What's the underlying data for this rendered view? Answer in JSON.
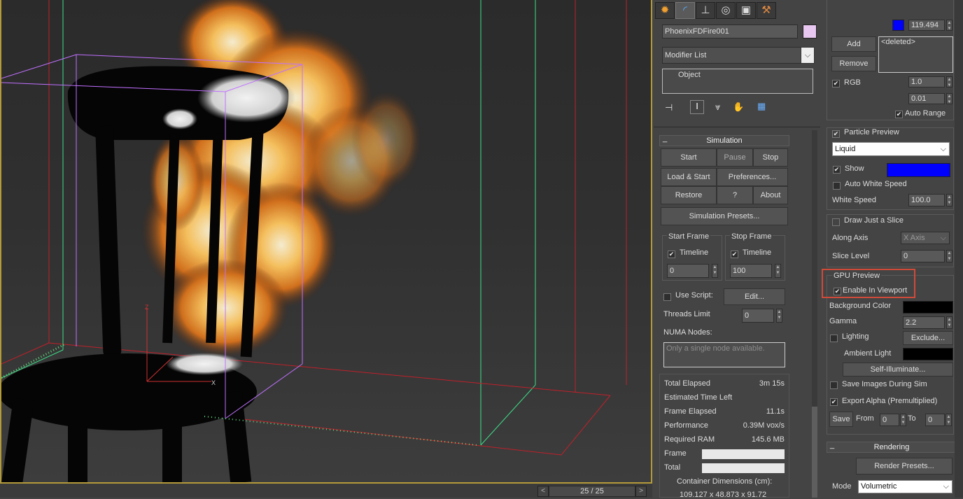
{
  "viewport": {
    "gizmo_axes": {
      "x": "X",
      "z": "Z"
    }
  },
  "timebar": {
    "frame_readout": "25 / 25",
    "prev_label": "<",
    "next_label": ">"
  },
  "command_panel": {
    "tabs": [
      {
        "name": "create",
        "icon": "sun-icon"
      },
      {
        "name": "modify",
        "icon": "modify-arc-icon"
      },
      {
        "name": "hierarchy",
        "icon": "hierarchy-icon"
      },
      {
        "name": "motion",
        "icon": "motion-circle-icon"
      },
      {
        "name": "display",
        "icon": "display-monitor-icon"
      },
      {
        "name": "utilities",
        "icon": "hammer-icon"
      }
    ],
    "object_name": "PhoenixFDFire001",
    "object_color": "#e8c8f0",
    "modifier_list_label": "Modifier List",
    "stack_items": [
      "Object"
    ],
    "simulation": {
      "title": "Simulation",
      "start": "Start",
      "pause": "Pause",
      "stop": "Stop",
      "load_start": "Load & Start",
      "preferences": "Preferences...",
      "restore": "Restore",
      "help": "?",
      "about": "About",
      "presets": "Simulation Presets...",
      "start_frame": {
        "title": "Start Frame",
        "timeline": "Timeline",
        "timeline_checked": true,
        "value": "0"
      },
      "stop_frame": {
        "title": "Stop Frame",
        "timeline": "Timeline",
        "timeline_checked": true,
        "value": "100"
      },
      "use_script": "Use Script:",
      "use_script_checked": false,
      "edit": "Edit...",
      "threads_limit_label": "Threads Limit",
      "threads_limit_value": "0",
      "numa_label": "NUMA Nodes:",
      "numa_placeholder": "Only a single node available."
    },
    "stats": {
      "total_elapsed_label": "Total Elapsed",
      "total_elapsed": "3m 15s",
      "eta_label": "Estimated Time Left",
      "frame_elapsed_label": "Frame Elapsed",
      "frame_elapsed": "11.1s",
      "performance_label": "Performance",
      "performance": "0.39M vox/s",
      "ram_label": "Required RAM",
      "ram": "145.6 MB",
      "frame_label": "Frame",
      "total_label": "Total",
      "container_label": "Container Dimensions (cm):",
      "container_value": "109.127 x 48.873 x 91.72"
    },
    "right": {
      "top_color": "#0000ff",
      "top_value": "119.494",
      "add": "Add",
      "remove": "Remove",
      "deleted_item": "<deleted>",
      "rgb_label": "RGB",
      "rgb_checked": true,
      "rgb_value_1": "1.0",
      "rgb_value_2": "0.01",
      "auto_range_label": "Auto Range",
      "auto_range_checked": true,
      "particle_preview_label": "Particle Preview",
      "particle_preview_checked": true,
      "particle_type": "Liquid",
      "show_label": "Show",
      "show_checked": true,
      "show_color": "#0000ff",
      "auto_white_speed_label": "Auto White Speed",
      "auto_white_speed_checked": false,
      "white_speed_label": "White Speed",
      "white_speed_value": "100.0",
      "draw_slice_label": "Draw Just a Slice",
      "draw_slice_checked": false,
      "along_axis_label": "Along Axis",
      "along_axis_value": "X Axis",
      "slice_level_label": "Slice Level",
      "slice_level_value": "0",
      "gpu_preview_title": "GPU Preview",
      "enable_viewport_label": "Enable In Viewport",
      "enable_viewport_checked": true,
      "background_color_label": "Background Color",
      "background_color": "#000000",
      "gamma_label": "Gamma",
      "gamma_value": "2.2",
      "lighting_label": "Lighting",
      "lighting_checked": false,
      "exclude": "Exclude...",
      "ambient_light_label": "Ambient Light",
      "ambient_color": "#000000",
      "self_illuminate": "Self-Illuminate...",
      "save_images_label": "Save Images During Sim",
      "save_images_checked": false,
      "export_alpha_label": "Export Alpha (Premultiplied)",
      "export_alpha_checked": true,
      "save": "Save",
      "from_label": "From",
      "from_value": "0",
      "to_label": "To",
      "to_value": "0",
      "rendering_title": "Rendering",
      "render_presets": "Render Presets...",
      "mode_label": "Mode",
      "mode_value": "Volumetric"
    },
    "highlight_color": "#d04a3a"
  }
}
